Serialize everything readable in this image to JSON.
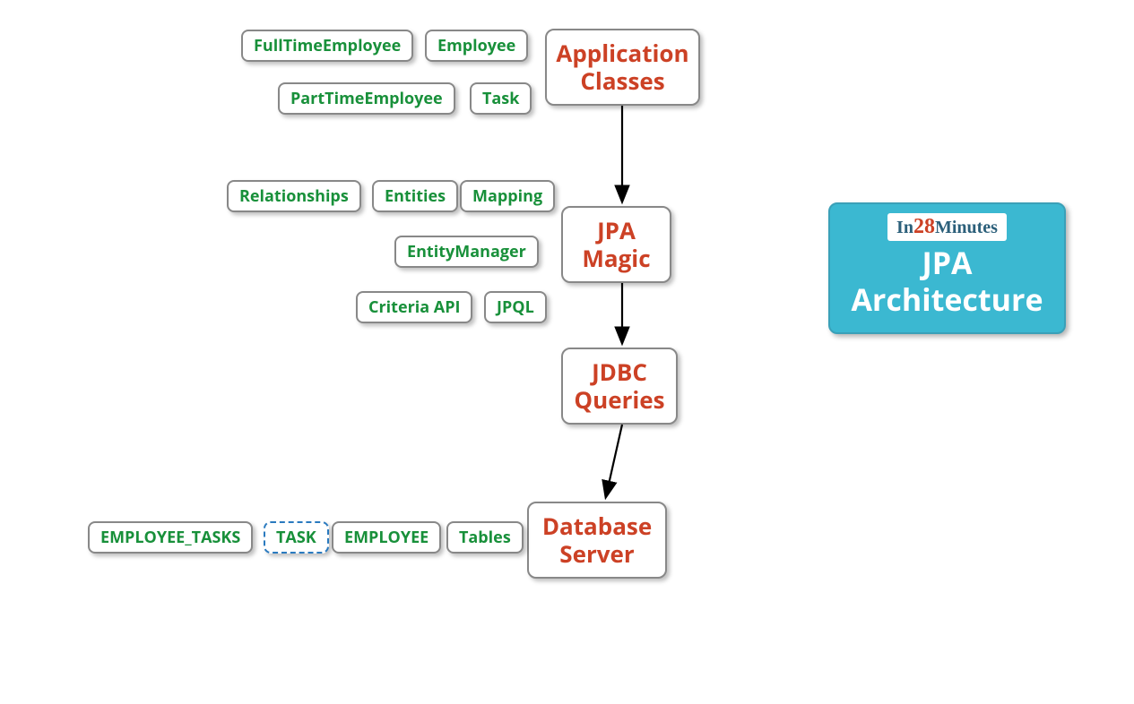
{
  "nodes": {
    "application_classes": {
      "label": "Application\nClasses"
    },
    "jpa_magic": {
      "label": "JPA\nMagic"
    },
    "jdbc_queries": {
      "label": "JDBC\nQueries"
    },
    "database_server": {
      "label": "Database\nServer"
    }
  },
  "sub": {
    "full_time_employee": "FullTimeEmployee",
    "employee": "Employee",
    "part_time_employee": "PartTimeEmployee",
    "task": "Task",
    "relationships": "Relationships",
    "entities": "Entities",
    "mapping": "Mapping",
    "entity_manager": "EntityManager",
    "criteria_api": "Criteria API",
    "jpql": "JPQL",
    "employee_tasks": "EMPLOYEE_TASKS",
    "task_upper": "TASK",
    "employee_upper": "EMPLOYEE",
    "tables": "Tables"
  },
  "title": {
    "logo_prefix": "In",
    "logo_number": "28",
    "logo_suffix": "Minutes",
    "line1": "JPA",
    "line2": "Architecture"
  },
  "arrows": [
    {
      "from": "application_classes",
      "to": "jpa_magic"
    },
    {
      "from": "jpa_magic",
      "to": "jdbc_queries"
    },
    {
      "from": "jdbc_queries",
      "to": "database_server"
    }
  ]
}
